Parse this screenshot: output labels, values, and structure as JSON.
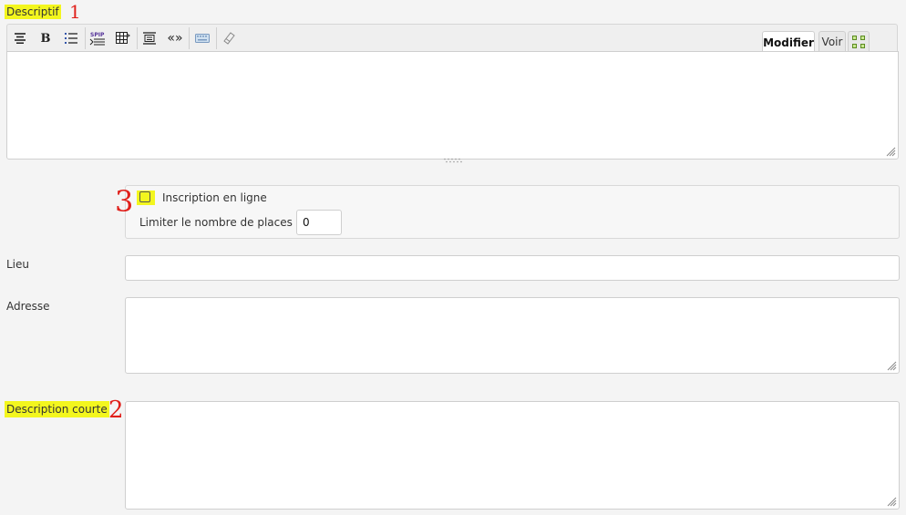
{
  "descriptif": {
    "label": "Descriptif",
    "annotation": "1"
  },
  "toolbar": {
    "buttons": [
      {
        "name": "align-center-icon",
        "glyph": "☰"
      },
      {
        "name": "bold-icon",
        "glyph": "B"
      },
      {
        "name": "list-icon",
        "glyph": "☷"
      },
      {
        "name": "spip-doc-icon",
        "glyph": "SPIP"
      },
      {
        "name": "table-icon",
        "glyph": "▦"
      },
      {
        "name": "block-icon",
        "glyph": "▤"
      },
      {
        "name": "quotes-icon",
        "glyph": "«»"
      },
      {
        "name": "keyboard-icon",
        "glyph": "⌨"
      },
      {
        "name": "eraser-icon",
        "glyph": "◇"
      }
    ],
    "tabs": {
      "modifier": "Modifier",
      "voir": "Voir"
    }
  },
  "inscription": {
    "annotation": "3",
    "checkbox_label": "Inscription en ligne",
    "checked": false,
    "limit_label": "Limiter le nombre de places",
    "limit_value": "0"
  },
  "lieu": {
    "label": "Lieu",
    "value": ""
  },
  "adresse": {
    "label": "Adresse",
    "value": ""
  },
  "description_courte": {
    "label": "Description courte",
    "annotation": "2",
    "value": ""
  },
  "colors": {
    "highlight": "#f3f61e",
    "annotation": "#e0201b"
  }
}
